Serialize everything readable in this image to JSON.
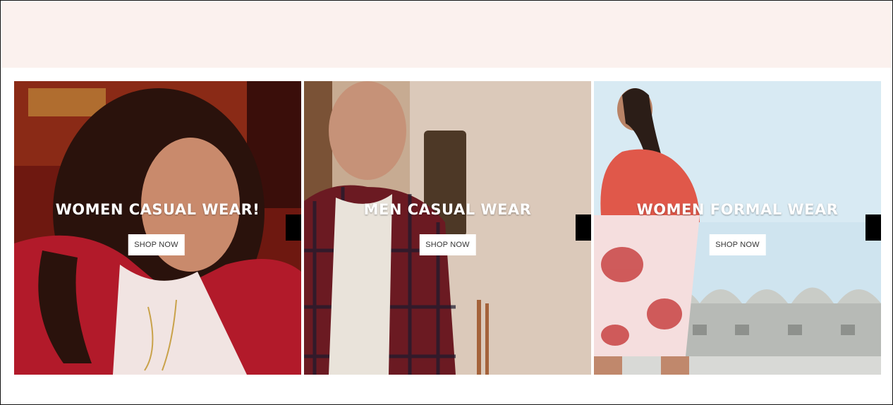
{
  "tiles": [
    {
      "title": "WOMEN CASUAL WEAR!",
      "button": "SHOP NOW",
      "image": "woman-red-cardigan-photo"
    },
    {
      "title": "MEN CASUAL WEAR",
      "button": "SHOP NOW",
      "image": "man-plaid-shirt-photo"
    },
    {
      "title": "WOMEN FORMAL WEAR",
      "button": "SHOP NOW",
      "image": "woman-floral-skirt-photo"
    }
  ],
  "colors": {
    "top_band": "#fbf1ee",
    "tile1_bg": "#7a1a12",
    "tile2_bg": "#dccbbd",
    "tile3_bg": "#c9e1ee"
  }
}
